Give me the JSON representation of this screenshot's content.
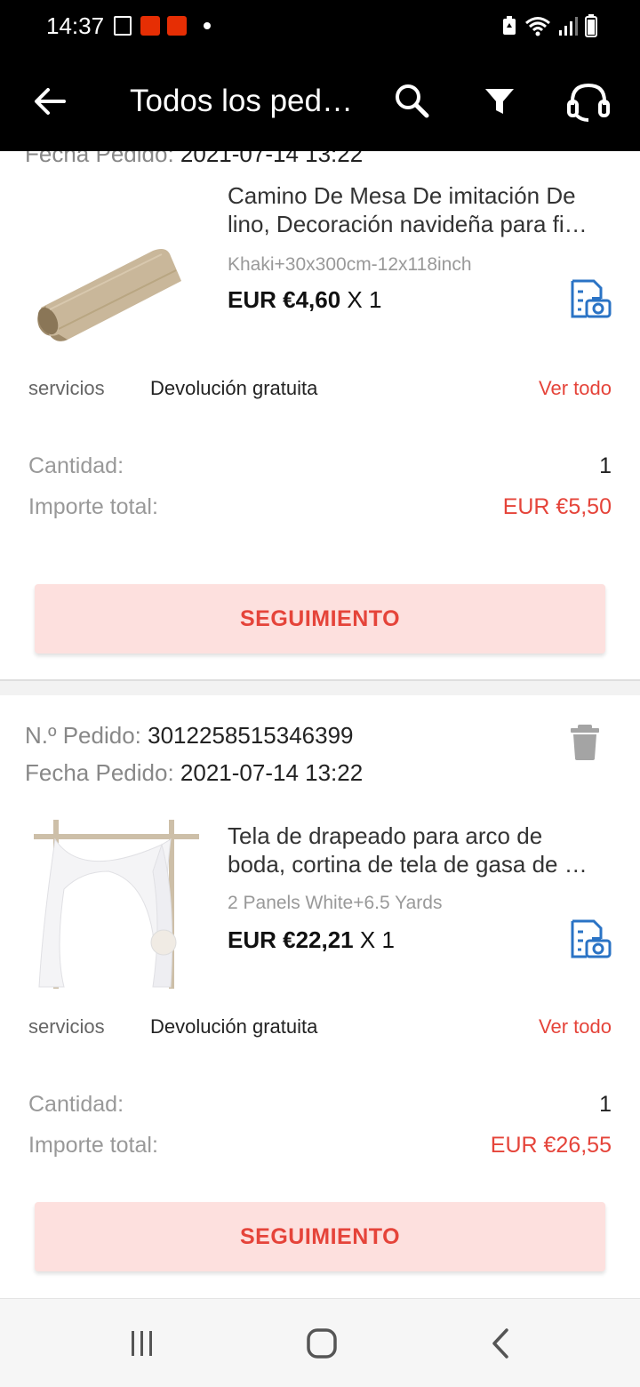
{
  "status_bar": {
    "time": "14:37",
    "icons": [
      "gallery-icon",
      "aliexpress-icon",
      "aliexpress-icon",
      "dot-icon",
      "battery-saver-icon",
      "wifi-icon",
      "signal-icon",
      "battery-icon"
    ]
  },
  "header": {
    "title": "Todos los ped…",
    "back_icon": "arrow-left-icon",
    "search_icon": "search-icon",
    "filter_icon": "filter-icon",
    "support_icon": "headset-icon"
  },
  "colors": {
    "accent": "#e5443a",
    "button_bg": "#fde0de",
    "header_bg": "#000000",
    "snapshot_icon": "#2a73c5"
  },
  "orders": [
    {
      "partial_date_label": "Fecha Pedido:",
      "partial_date_value": "2021-07-14 13:22",
      "product_title_line1": "Camino De Mesa De imitación De",
      "product_title_line2": "lino, Decoración navideña para fi…",
      "variant": "Khaki+30x300cm-12x118inch",
      "price": "EUR €4,60",
      "qty": "X 1",
      "services_label": "servicios",
      "services_value": "Devolución gratuita",
      "see_all": "Ver todo",
      "quantity_label": "Cantidad:",
      "quantity_value": "1",
      "total_label": "Importe total:",
      "total_value": "EUR €5,50",
      "track_button": "SEGUIMIENTO"
    },
    {
      "order_no_label": "N.º Pedido:",
      "order_no_value": "3012258515346399",
      "date_label": "Fecha Pedido:",
      "date_value": "2021-07-14 13:22",
      "product_title_line1": "Tela de drapeado para arco de",
      "product_title_line2": "boda, cortina de tela de gasa de …",
      "variant": "2 Panels White+6.5 Yards",
      "price": "EUR €22,21",
      "qty": "X 1",
      "services_label": "servicios",
      "services_value": "Devolución gratuita",
      "see_all": "Ver todo",
      "quantity_label": "Cantidad:",
      "quantity_value": "1",
      "total_label": "Importe total:",
      "total_value": "EUR €26,55",
      "track_button": "SEGUIMIENTO"
    }
  ],
  "nav_bar": {
    "recents_icon": "recents-icon",
    "home_icon": "home-icon",
    "back_icon": "back-chevron-icon"
  }
}
